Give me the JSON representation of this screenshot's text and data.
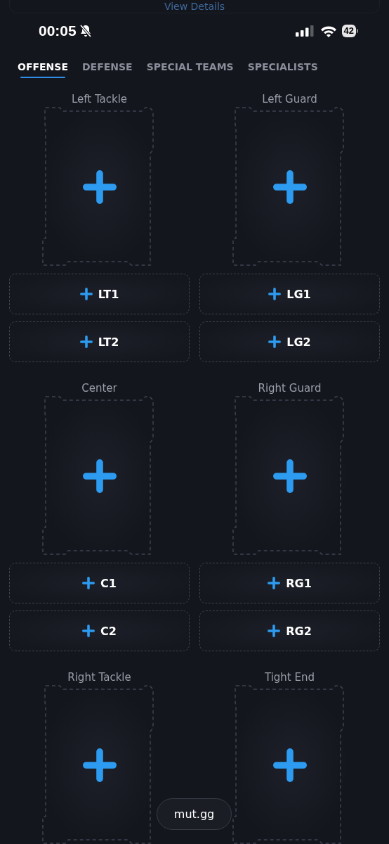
{
  "top_card": {
    "link": "View Details"
  },
  "status_bar": {
    "time": "00:05",
    "silent": true,
    "battery": "42"
  },
  "tabs": [
    {
      "label": "OFFENSE",
      "selected": true
    },
    {
      "label": "DEFENSE",
      "selected": false
    },
    {
      "label": "SPECIAL TEAMS",
      "selected": false
    },
    {
      "label": "SPECIALISTS",
      "selected": false
    }
  ],
  "positions": [
    {
      "name": "Left Tackle",
      "slots": [
        "LT1",
        "LT2"
      ]
    },
    {
      "name": "Left Guard",
      "slots": [
        "LG1",
        "LG2"
      ]
    },
    {
      "name": "Center",
      "slots": [
        "C1",
        "C2"
      ]
    },
    {
      "name": "Right Guard",
      "slots": [
        "RG1",
        "RG2"
      ]
    },
    {
      "name": "Right Tackle"
    },
    {
      "name": "Tight End"
    }
  ],
  "site_pill": "mut.gg"
}
